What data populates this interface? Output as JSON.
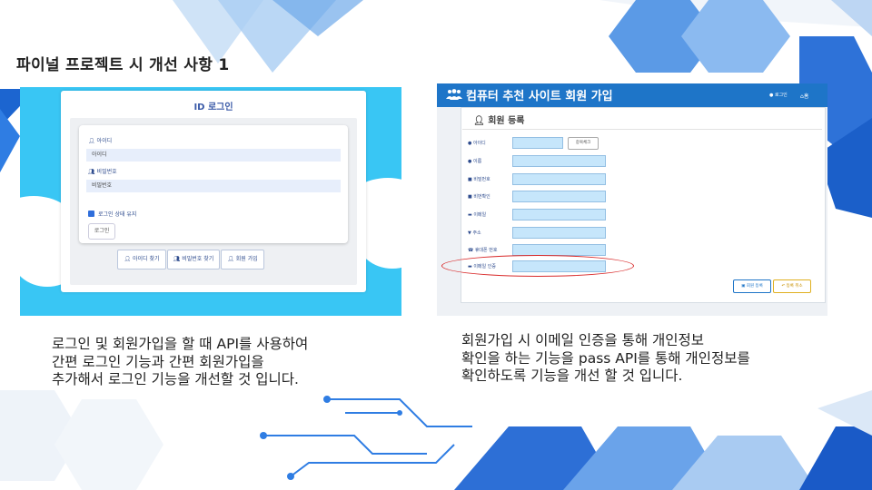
{
  "slide": {
    "title": "파이널 프로젝트 시 개선 사항 1"
  },
  "left_screenshot": {
    "card_title": "ID 로그인",
    "id_label": "아이디",
    "id_placeholder": "아이디",
    "pw_label": "비밀번호",
    "pw_placeholder": "비밀번호",
    "remember_label": "로그인 상태 유지",
    "remember_checked": true,
    "login_button": "로그인",
    "find_id_button": "아이디 찾기",
    "find_pw_button": "비밀번호 찾기",
    "signup_button": "회원 가입",
    "background_color": "#39c6f4"
  },
  "right_screenshot": {
    "header_title": "컴퓨터 추천 사이트 회원 가입",
    "nav_login": "로그인",
    "nav_home": "홈",
    "section_title": "회원 등록",
    "fields": [
      {
        "label": "아이디",
        "icon": "user-icon"
      },
      {
        "label": "이름",
        "icon": "user-icon"
      },
      {
        "label": "비밀번호",
        "icon": "lock-icon"
      },
      {
        "label": "비번확인",
        "icon": "lock-icon"
      },
      {
        "label": "이메일",
        "icon": "envelope-icon"
      },
      {
        "label": "주소",
        "icon": "map-marker-icon"
      },
      {
        "label": "휴대폰 번호",
        "icon": "phone-icon"
      },
      {
        "label": "이메일 인증",
        "icon": "envelope-icon"
      }
    ],
    "duplicate_check_button": "중복체크",
    "register_button": "회원 등록",
    "cancel_button": "등록 취소",
    "header_color": "#1e75c8",
    "highlight_color": "#d92b2b"
  },
  "left_text": [
    "로그인 및 회원가입을 할 때 API를 사용하여",
    "간편 로그인 기능과 간편 회원가입을",
    "추가해서 로그인 기능을 개선할 것 입니다."
  ],
  "right_text": [
    "회원가입 시 이메일 인증을 통해 개인정보",
    "확인을 하는 기능을 pass API를 통해 개인정보를",
    "확인하도록 기능을 개선 할 것 입니다."
  ]
}
